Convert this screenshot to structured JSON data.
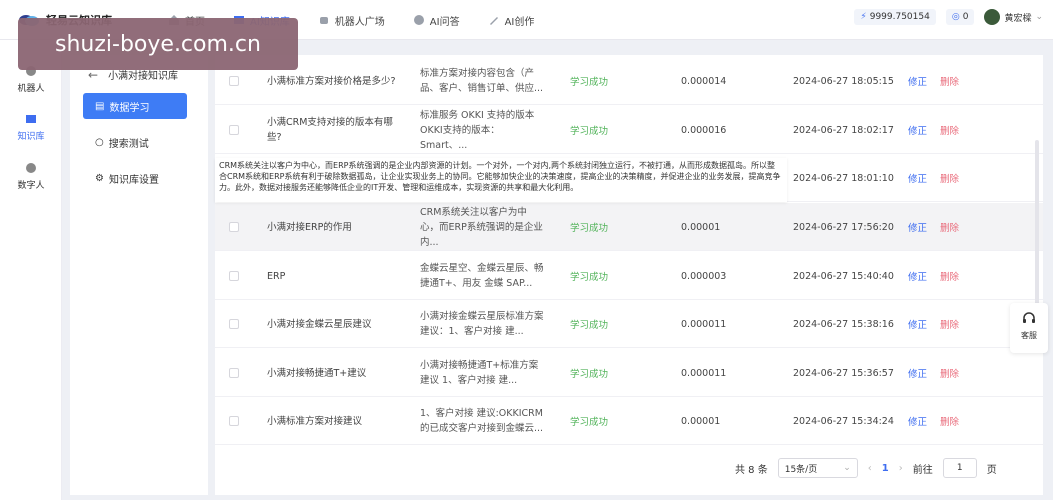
{
  "app": {
    "brand": "轻易云知识库"
  },
  "watermark": "shuzi-boye.com.cn",
  "nav": [
    {
      "label": "首页",
      "icon": "home-icon"
    },
    {
      "label": "AI知识库",
      "icon": "book-icon"
    },
    {
      "label": "机器人广场",
      "icon": "robot-icon"
    },
    {
      "label": "AI问答",
      "icon": "chat-icon"
    },
    {
      "label": "AI创作",
      "icon": "pen-icon"
    }
  ],
  "header": {
    "credits": "9999.750154",
    "messages": "0",
    "user": "黄宏樑"
  },
  "rail": [
    {
      "label": "机器人",
      "icon": "robot-icon"
    },
    {
      "label": "知识库",
      "icon": "book-icon"
    },
    {
      "label": "数字人",
      "icon": "digital-human-icon"
    }
  ],
  "submenu": {
    "title": "小满对接知识库",
    "items": [
      {
        "label": "数据学习",
        "icon": "document-icon"
      },
      {
        "label": "搜索测试",
        "icon": "search-icon"
      },
      {
        "label": "知识库设置",
        "icon": "gear-icon"
      }
    ]
  },
  "table": {
    "rows": [
      {
        "title": "小满标准方案对接价格是多少?",
        "content": "标准方案对接内容包含（产品、客户、销售订单、供应...",
        "status": "学习成功",
        "value": "0.000014",
        "time": "2024-06-27 18:05:15",
        "edit": "修正",
        "delete": "删除"
      },
      {
        "title": "小满CRM支持对接的版本有哪些?",
        "content": "标准服务 OKKI 支持的版本 OKKI支持的版本：Smart、...",
        "status": "学习成功",
        "value": "0.000016",
        "time": "2024-06-27 18:02:17",
        "edit": "修正",
        "delete": "删除"
      },
      {
        "title": "",
        "content": "",
        "status": "",
        "value": "",
        "time": "2024-06-27 18:01:10",
        "edit": "修正",
        "delete": "删除"
      },
      {
        "title": "小满对接ERP的作用",
        "content": "CRM系统关注以客户为中心，而ERP系统强调的是企业内...",
        "status": "学习成功",
        "value": "0.00001",
        "time": "2024-06-27 17:56:20",
        "edit": "修正",
        "delete": "删除"
      },
      {
        "title": "ERP",
        "content": "金蝶云星空、金蝶云星辰、畅捷通T+、用友 金蝶 SAP...",
        "status": "学习成功",
        "value": "0.000003",
        "time": "2024-06-27 15:40:40",
        "edit": "修正",
        "delete": "删除"
      },
      {
        "title": "小满对接金蝶云星辰建议",
        "content": "小满对接金蝶云星辰标准方案建议：1、客户对接 建...",
        "status": "学习成功",
        "value": "0.000011",
        "time": "2024-06-27 15:38:16",
        "edit": "修正",
        "delete": "删除"
      },
      {
        "title": "小满对接畅捷通T+建议",
        "content": "小满对接畅捷通T+标准方案建议 1、客户对接 建...",
        "status": "学习成功",
        "value": "0.000011",
        "time": "2024-06-27 15:36:57",
        "edit": "修正",
        "delete": "删除"
      },
      {
        "title": "小满标准方案对接建议",
        "content": "1、客户对接 建议:OKKICRM的已成交客户对接到金蝶云...",
        "status": "学习成功",
        "value": "0.00001",
        "time": "2024-06-27 15:34:24",
        "edit": "修正",
        "delete": "删除"
      }
    ]
  },
  "tooltip": "CRM系统关注以客户为中心，而ERP系统强调的是企业内部资源的计划。一个对外，一个对内,两个系统封闭独立运行，不被打通，从而形成数据孤岛。所以整合CRM系统和ERP系统有利于破除数据孤岛，让企业实现业务上的协同。它能够加快企业的决策速度，提高企业的决策精度，并促进企业的业务发展，提高竞争力。此外，数据对接服务还能够降低企业的IT开发、管理和运维成本，实现资源的共享和最大化利用。",
  "pagination": {
    "total": "共 8 条",
    "page_size": "15条/页",
    "current": "1",
    "goto_label": "前往",
    "goto_value": "1",
    "page_suffix": "页"
  },
  "service": {
    "label": "客服"
  },
  "colors": {
    "accent": "#3e6df0",
    "success": "#52b35a",
    "danger": "#e96a7a"
  }
}
